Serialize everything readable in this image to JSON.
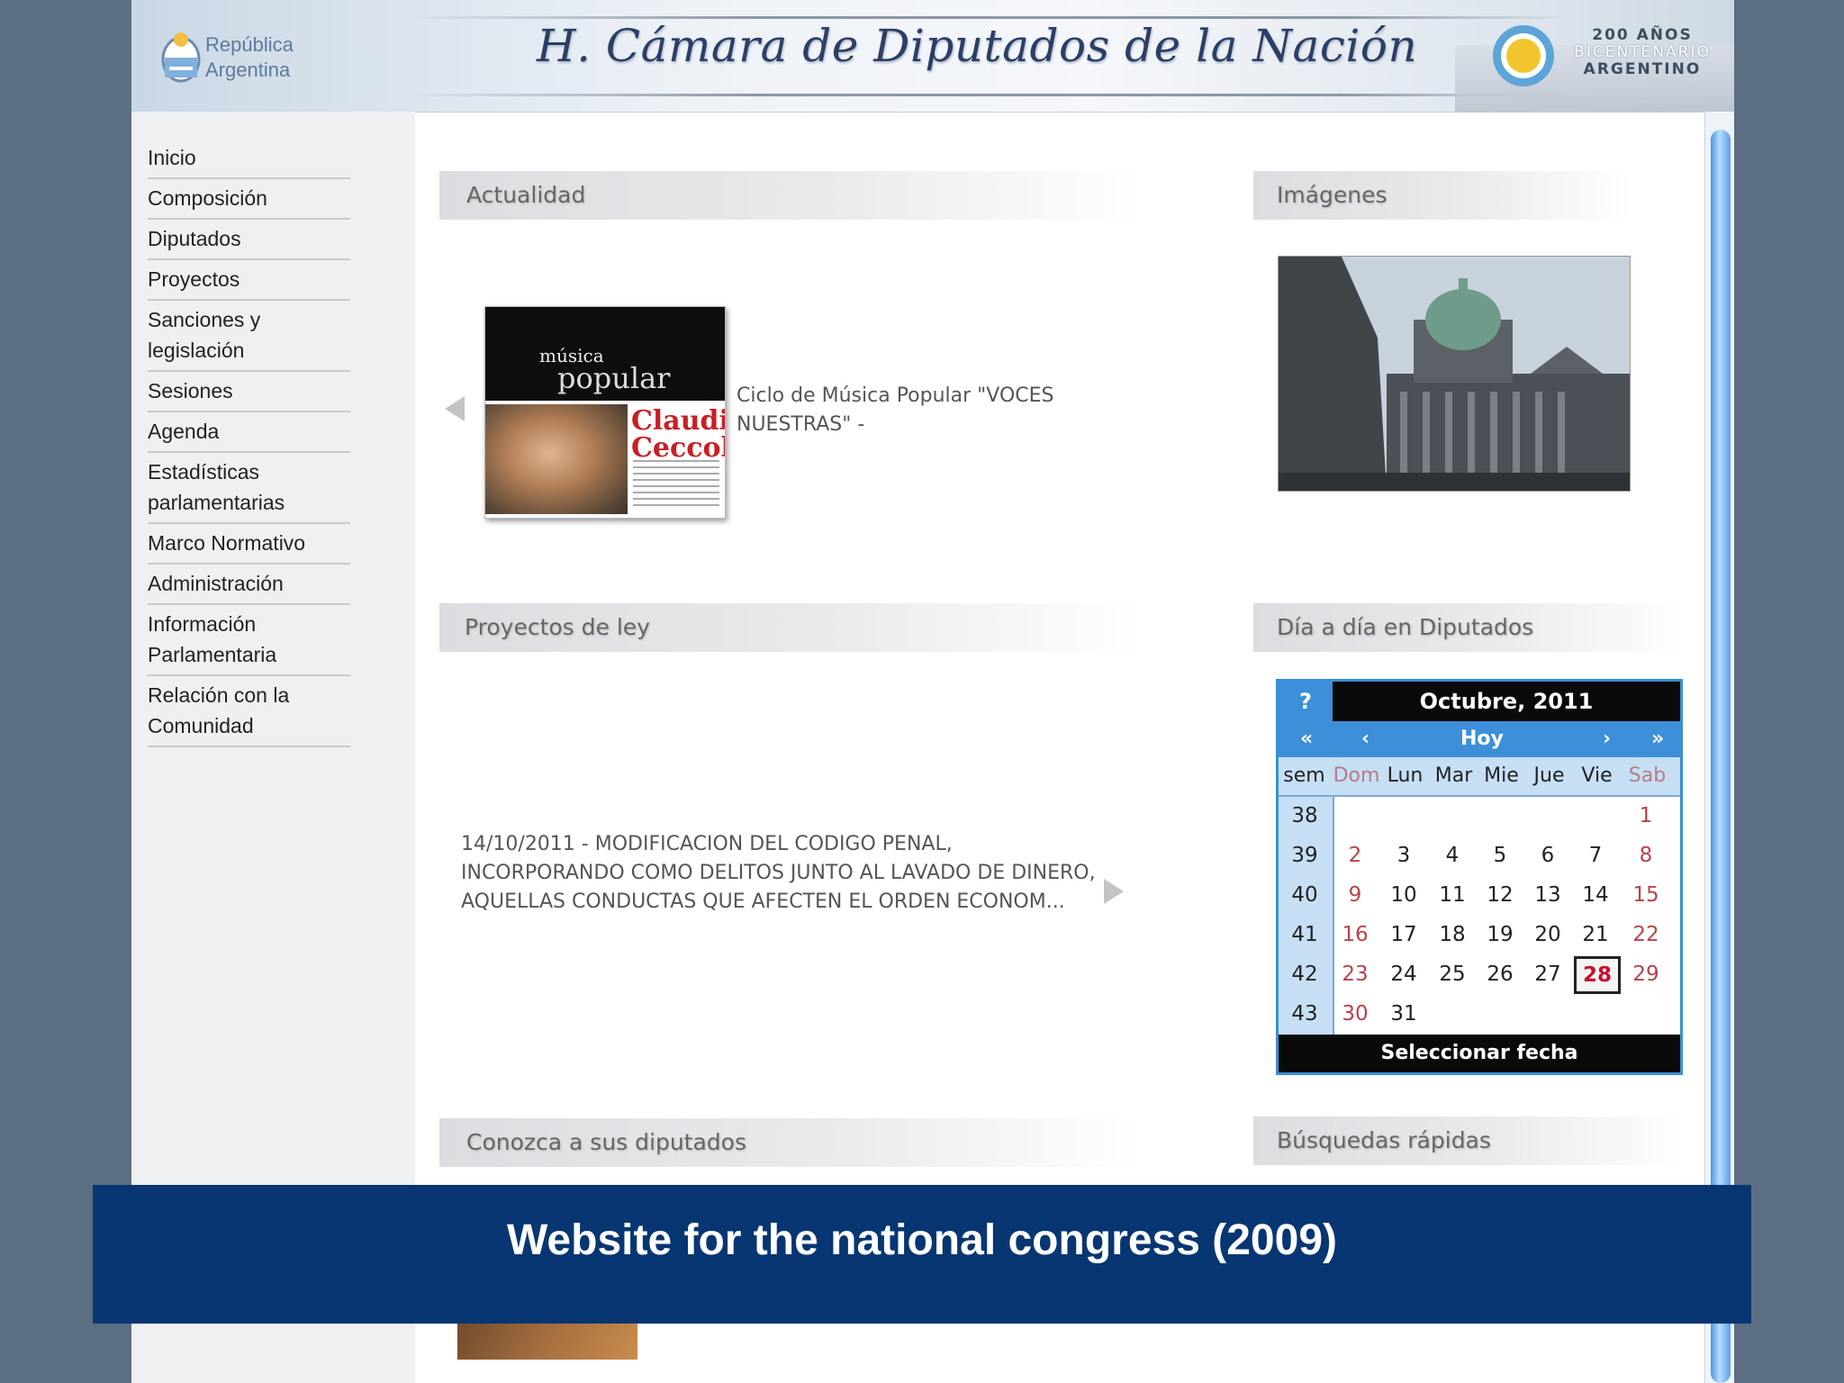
{
  "header": {
    "republica": "República Argentina",
    "title": "H. Cámara de Diputados de la Nación",
    "bicentenario": [
      "200 AÑOS",
      "BICENTENARIO",
      "ARGENTINO"
    ]
  },
  "sidebar": {
    "items": [
      {
        "label": "Inicio"
      },
      {
        "label": "Composición"
      },
      {
        "label": "Diputados"
      },
      {
        "label": "Proyectos"
      },
      {
        "label": "Sanciones y legislación"
      },
      {
        "label": "Sesiones"
      },
      {
        "label": "Agenda"
      },
      {
        "label": "Estadísticas parlamentarias"
      },
      {
        "label": "Marco Normativo"
      },
      {
        "label": "Administración"
      },
      {
        "label": "Información Parlamentaria"
      },
      {
        "label": "Relación con la Comunidad"
      }
    ]
  },
  "sections": {
    "actualidad": "Actualidad",
    "imagenes": "Imágenes",
    "proyectos": "Proyectos de ley",
    "dia_a_dia": "Día a día en Diputados",
    "conozca": "Conozca a sus diputados",
    "busquedas": "Búsquedas rápidas"
  },
  "news": {
    "text": "Ciclo de Música Popular \"VOCES NUESTRAS\" -",
    "poster_line1": "música",
    "poster_line2": "popular",
    "poster_name": "Claudio Ceccoli"
  },
  "projects": {
    "text": "14/10/2011 - MODIFICACION DEL CODIGO PENAL, INCORPORANDO COMO DELITOS JUNTO AL LAVADO DE DINERO, AQUELLAS CONDUCTAS QUE AFECTEN EL ORDEN ECONOM..."
  },
  "calendar": {
    "help": "?",
    "title": "Octubre, 2011",
    "nav": {
      "prev_year": "«",
      "prev_month": "‹",
      "today": "Hoy",
      "next_month": "›",
      "next_year": "»"
    },
    "weekdays": [
      "sem",
      "Dom",
      "Lun",
      "Mar",
      "Mie",
      "Jue",
      "Vie",
      "Sab"
    ],
    "weeks": [
      {
        "num": "38",
        "days": [
          "",
          "",
          "",
          "",
          "",
          "",
          "1"
        ]
      },
      {
        "num": "39",
        "days": [
          "2",
          "3",
          "4",
          "5",
          "6",
          "7",
          "8"
        ]
      },
      {
        "num": "40",
        "days": [
          "9",
          "10",
          "11",
          "12",
          "13",
          "14",
          "15"
        ]
      },
      {
        "num": "41",
        "days": [
          "16",
          "17",
          "18",
          "19",
          "20",
          "21",
          "22"
        ]
      },
      {
        "num": "42",
        "days": [
          "23",
          "24",
          "25",
          "26",
          "27",
          "28",
          "29"
        ]
      },
      {
        "num": "43",
        "days": [
          "30",
          "31",
          "",
          "",
          "",
          "",
          ""
        ]
      }
    ],
    "today": "28",
    "footer": "Seleccionar fecha"
  },
  "caption": "Website for the national congress (2009)",
  "colors": {
    "caption_bg": "#073672",
    "calendar_accent": "#3c8fd8",
    "page_bg": "#5b6e82"
  }
}
